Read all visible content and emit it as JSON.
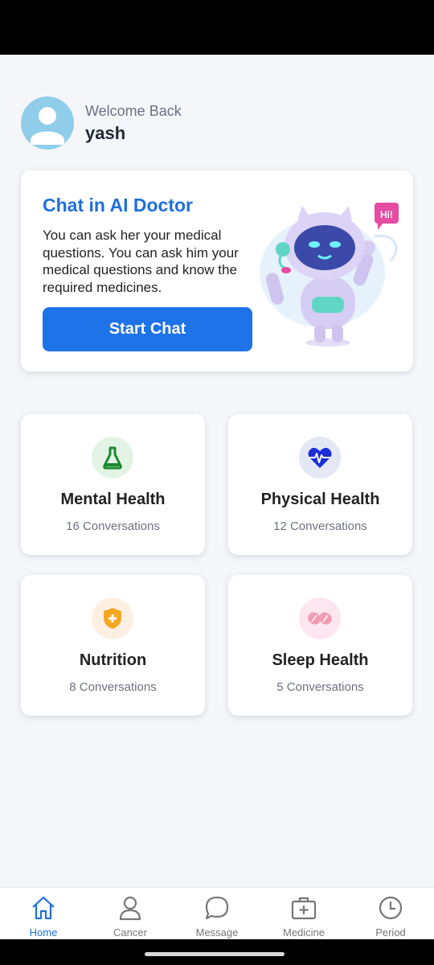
{
  "profile": {
    "welcome": "Welcome Back",
    "name": "yash"
  },
  "ai_card": {
    "title": "Chat in AI Doctor",
    "description": "You can ask her your medical questions. You can ask him your medical questions and know the required medicines.",
    "button": "Start Chat",
    "robot_badge": "Hi!"
  },
  "categories": [
    {
      "title": "Mental Health",
      "count": "16 Conversations",
      "icon": "flask-icon",
      "color": "#1a8a2e",
      "bg": "#e3f4e6"
    },
    {
      "title": "Physical Health",
      "count": "12 Conversations",
      "icon": "heart-pulse-icon",
      "color": "#1b2fd6",
      "bg": "#e4e8f5"
    },
    {
      "title": "Nutrition",
      "count": "8 Conversations",
      "icon": "shield-plus-icon",
      "color": "#f5a623",
      "bg": "#fdf0e2"
    },
    {
      "title": "Sleep Health",
      "count": "5 Conversations",
      "icon": "pills-icon",
      "color": "#f39ab4",
      "bg": "#fde6ef"
    }
  ],
  "nav": {
    "items": [
      {
        "label": "Home",
        "icon": "home-icon",
        "active": true
      },
      {
        "label": "Cancer",
        "icon": "person-icon",
        "active": false
      },
      {
        "label": "Message",
        "icon": "chat-bubble-icon",
        "active": false
      },
      {
        "label": "Medicine",
        "icon": "medkit-icon",
        "active": false
      },
      {
        "label": "Period",
        "icon": "clock-icon",
        "active": false
      }
    ],
    "active_color": "#1e6fd9",
    "inactive_color": "#777777"
  }
}
